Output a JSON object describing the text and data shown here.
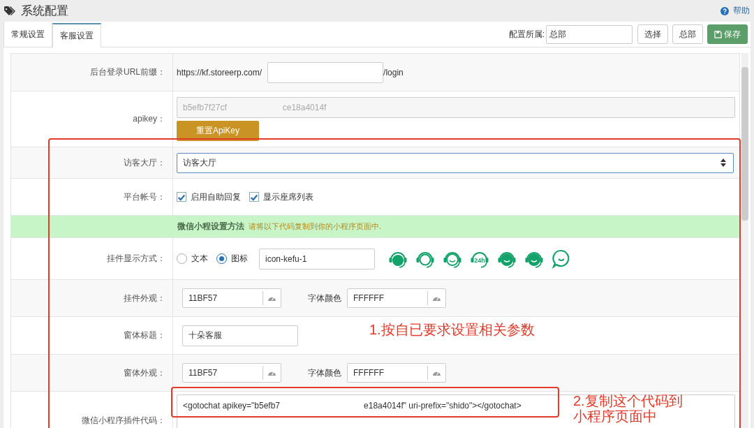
{
  "header": {
    "title": "系统配置",
    "help": "帮助"
  },
  "tabs": [
    {
      "label": "常规设置",
      "selected": false
    },
    {
      "label": "客服设置",
      "selected": true
    }
  ],
  "toolbar": {
    "owner_label": "配置所属:",
    "owner_value": "总部",
    "buttons": [
      {
        "label": "选择",
        "kind": "plain"
      },
      {
        "label": "总部",
        "kind": "plain"
      },
      {
        "label": "保存",
        "kind": "save"
      }
    ]
  },
  "rows": [
    {
      "kind": "url",
      "label": "后台登录URL前缀：",
      "prefix": "https://kf.storeerp.com/",
      "suffix": "/login"
    },
    {
      "kind": "apikey",
      "label": "apikey：",
      "value_start": "b5efb7f27cf",
      "value_end": "ce18a4014f",
      "button": "重置ApiKey"
    },
    {
      "kind": "select",
      "label": "访客大厅：",
      "value": "访客大厅"
    },
    {
      "kind": "checkboxes",
      "label": "平台帐号：",
      "options": [
        {
          "label": "启用自助回复",
          "checked": true
        },
        {
          "label": "显示座席列表",
          "checked": true
        }
      ]
    },
    {
      "kind": "banner",
      "title": "微信小程设置方法",
      "hint": "请将以下代码复制到你的小程序页面中."
    },
    {
      "kind": "radios",
      "label": "挂件显示方式：",
      "options": [
        {
          "label": "文本",
          "selected": false
        },
        {
          "label": "图标",
          "selected": true
        }
      ],
      "value": "icon-kefu-1",
      "icons": [
        {
          "kind": "headset-e"
        },
        {
          "kind": "headset-ring"
        },
        {
          "kind": "agent-girl"
        },
        {
          "kind": "headset-24h",
          "text": "24h"
        },
        {
          "kind": "agent-boy"
        },
        {
          "kind": "headset-smile"
        },
        {
          "kind": "chat-bubble"
        }
      ]
    },
    {
      "kind": "colors",
      "label": "挂件外观：",
      "value": "11BF57",
      "font_label": "字体颜色",
      "font_value": "FFFFFF"
    },
    {
      "kind": "text",
      "label": "窗体标题：",
      "value": "十朵客服"
    },
    {
      "kind": "colors",
      "label": "窗体外观：",
      "value": "11BF57",
      "font_label": "字体颜色",
      "font_value": "FFFFFF"
    },
    {
      "kind": "code",
      "label": "微信小程序插件代码：",
      "code_start": "<gotochat apikey=\"b5efb7",
      "code_end": "e18a4014f\" uri-prefix=\"shido\"></gotochat>"
    }
  ],
  "annotations": [
    {
      "text": "1.按自已要求设置相关参数"
    },
    {
      "text": "2.复制这个代码到小程序页面中"
    }
  ]
}
